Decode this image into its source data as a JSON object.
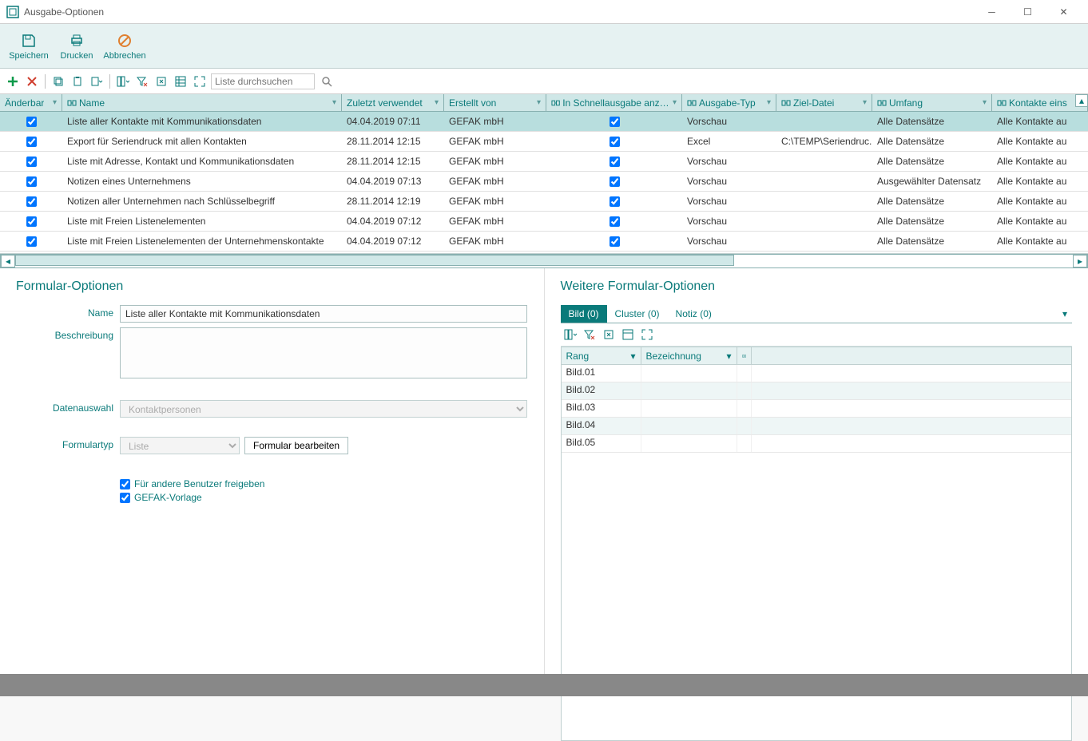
{
  "window": {
    "title": "Ausgabe-Optionen"
  },
  "ribbon": {
    "save": "Speichern",
    "print": "Drucken",
    "cancel": "Abbrechen"
  },
  "toolbar2": {
    "search_placeholder": "Liste durchsuchen"
  },
  "grid": {
    "columns": {
      "aenderbar": "Änderbar",
      "name": "Name",
      "zuletzt": "Zuletzt verwendet",
      "erstellt": "Erstellt von",
      "schnell": "In Schnellausgabe anzeig...",
      "typ": "Ausgabe-Typ",
      "ziel": "Ziel-Datei",
      "umfang": "Umfang",
      "kontakte": "Kontakte eins"
    },
    "rows": [
      {
        "aenderbar": true,
        "name": "Liste aller Kontakte mit Kommunikationsdaten",
        "zuletzt": "04.04.2019 07:11",
        "erstellt": "GEFAK mbH",
        "schnell": true,
        "typ": "Vorschau",
        "ziel": "",
        "umfang": "Alle Datensätze",
        "kontakte": "Alle Kontakte au"
      },
      {
        "aenderbar": true,
        "name": "Export für Seriendruck mit allen Kontakten",
        "zuletzt": "28.11.2014 12:15",
        "erstellt": "GEFAK mbH",
        "schnell": true,
        "typ": "Excel",
        "ziel": "C:\\TEMP\\Seriendruc...",
        "umfang": "Alle Datensätze",
        "kontakte": "Alle Kontakte au"
      },
      {
        "aenderbar": true,
        "name": "Liste mit Adresse, Kontakt und Kommunikationsdaten",
        "zuletzt": "28.11.2014 12:15",
        "erstellt": "GEFAK mbH",
        "schnell": true,
        "typ": "Vorschau",
        "ziel": "",
        "umfang": "Alle Datensätze",
        "kontakte": "Alle Kontakte au"
      },
      {
        "aenderbar": true,
        "name": "Notizen eines Unternehmens",
        "zuletzt": "04.04.2019 07:13",
        "erstellt": "GEFAK mbH",
        "schnell": true,
        "typ": "Vorschau",
        "ziel": "",
        "umfang": "Ausgewählter Datensatz",
        "kontakte": "Alle Kontakte au"
      },
      {
        "aenderbar": true,
        "name": "Notizen aller Unternehmen nach Schlüsselbegriff",
        "zuletzt": "28.11.2014 12:19",
        "erstellt": "GEFAK mbH",
        "schnell": true,
        "typ": "Vorschau",
        "ziel": "",
        "umfang": "Alle Datensätze",
        "kontakte": "Alle Kontakte au"
      },
      {
        "aenderbar": true,
        "name": "Liste mit Freien Listenelementen",
        "zuletzt": "04.04.2019 07:12",
        "erstellt": "GEFAK mbH",
        "schnell": true,
        "typ": "Vorschau",
        "ziel": "",
        "umfang": "Alle Datensätze",
        "kontakte": "Alle Kontakte au"
      },
      {
        "aenderbar": true,
        "name": "Liste mit Freien Listenelementen der Unternehmenskontakte",
        "zuletzt": "04.04.2019 07:12",
        "erstellt": "GEFAK mbH",
        "schnell": true,
        "typ": "Vorschau",
        "ziel": "",
        "umfang": "Alle Datensätze",
        "kontakte": "Alle Kontakte au"
      }
    ]
  },
  "left_panel": {
    "title": "Formular-Optionen",
    "labels": {
      "name": "Name",
      "beschreibung": "Beschreibung",
      "datenauswahl": "Datenauswahl",
      "formulartyp": "Formulartyp"
    },
    "values": {
      "name": "Liste aller Kontakte mit Kommunikationsdaten",
      "beschreibung": "",
      "datenauswahl": "Kontaktpersonen",
      "formulartyp": "Liste"
    },
    "btn_edit": "Formular bearbeiten",
    "chk_share": "Für andere Benutzer freigeben",
    "chk_gefak": "GEFAK-Vorlage"
  },
  "right_panel": {
    "title": "Weitere Formular-Optionen",
    "tabs": {
      "bild": "Bild (0)",
      "cluster": "Cluster (0)",
      "notiz": "Notiz (0)"
    },
    "sub_columns": {
      "rang": "Rang",
      "bezeichnung": "Bezeichnung"
    },
    "rows": [
      {
        "rang": "Bild.01",
        "bez": ""
      },
      {
        "rang": "Bild.02",
        "bez": ""
      },
      {
        "rang": "Bild.03",
        "bez": ""
      },
      {
        "rang": "Bild.04",
        "bez": ""
      },
      {
        "rang": "Bild.05",
        "bez": ""
      }
    ]
  }
}
